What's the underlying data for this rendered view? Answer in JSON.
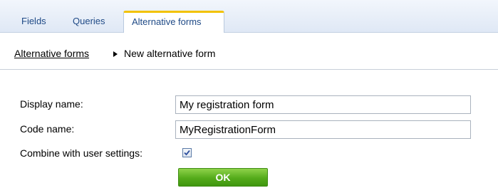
{
  "tabs": {
    "items": [
      {
        "label": "Fields"
      },
      {
        "label": "Queries"
      },
      {
        "label": "Alternative forms"
      }
    ],
    "active_color": "#f2c200"
  },
  "breadcrumb": {
    "parent": "Alternative forms",
    "current": "New alternative form"
  },
  "form": {
    "display_name": {
      "label": "Display name:",
      "value": "My registration form"
    },
    "code_name": {
      "label": "Code name:",
      "value": "MyRegistrationForm"
    },
    "combine": {
      "label": "Combine with user settings:",
      "checked": true
    },
    "ok_label": "OK",
    "ok_color": "#54ab1a"
  }
}
